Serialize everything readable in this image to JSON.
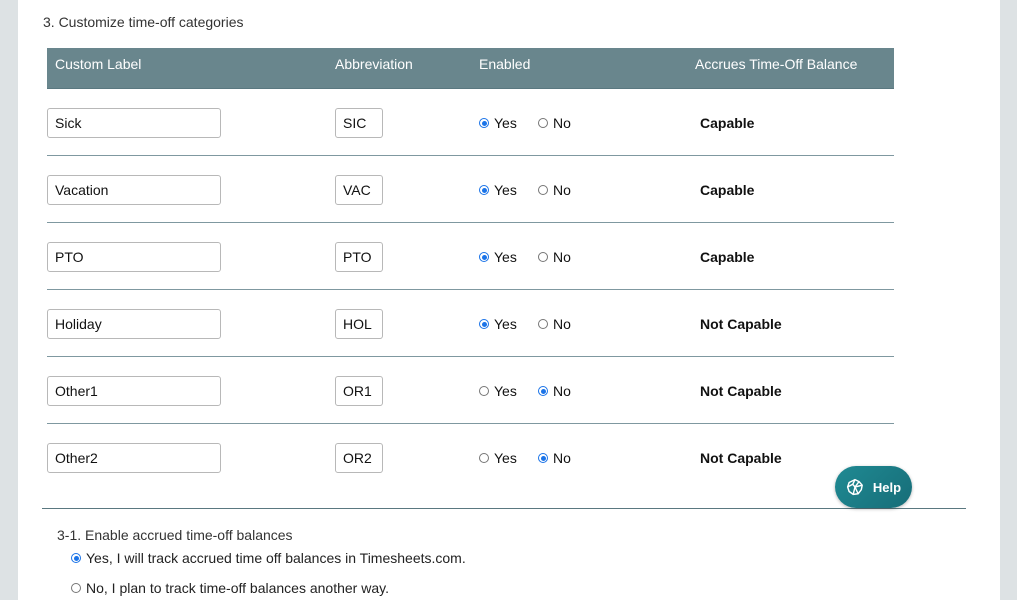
{
  "section": {
    "title": "3. Customize time-off categories"
  },
  "table": {
    "headers": {
      "label": "Custom Label",
      "abbreviation": "Abbreviation",
      "enabled": "Enabled",
      "accrues": "Accrues Time-Off Balance"
    },
    "yes_label": "Yes",
    "no_label": "No",
    "rows": [
      {
        "label": "Sick",
        "abbreviation": "SIC",
        "enabled": true,
        "accrues": "Capable"
      },
      {
        "label": "Vacation",
        "abbreviation": "VAC",
        "enabled": true,
        "accrues": "Capable"
      },
      {
        "label": "PTO",
        "abbreviation": "PTO",
        "enabled": true,
        "accrues": "Capable"
      },
      {
        "label": "Holiday",
        "abbreviation": "HOL",
        "enabled": true,
        "accrues": "Not Capable"
      },
      {
        "label": "Other1",
        "abbreviation": "OR1",
        "enabled": false,
        "accrues": "Not Capable"
      },
      {
        "label": "Other2",
        "abbreviation": "OR2",
        "enabled": false,
        "accrues": "Not Capable"
      }
    ]
  },
  "accrued": {
    "title": "3-1. Enable accrued time-off balances",
    "options": [
      {
        "label": "Yes, I will track accrued time off balances in Timesheets.com.",
        "selected": true
      },
      {
        "label": "No, I plan to track time-off balances another way.",
        "selected": false
      }
    ]
  },
  "help": {
    "label": "Help",
    "icon": "help-globe-icon"
  },
  "colors": {
    "header_bg": "#69868d",
    "radio_accent": "#1a73e8",
    "help_bg": "#1a7c86"
  }
}
